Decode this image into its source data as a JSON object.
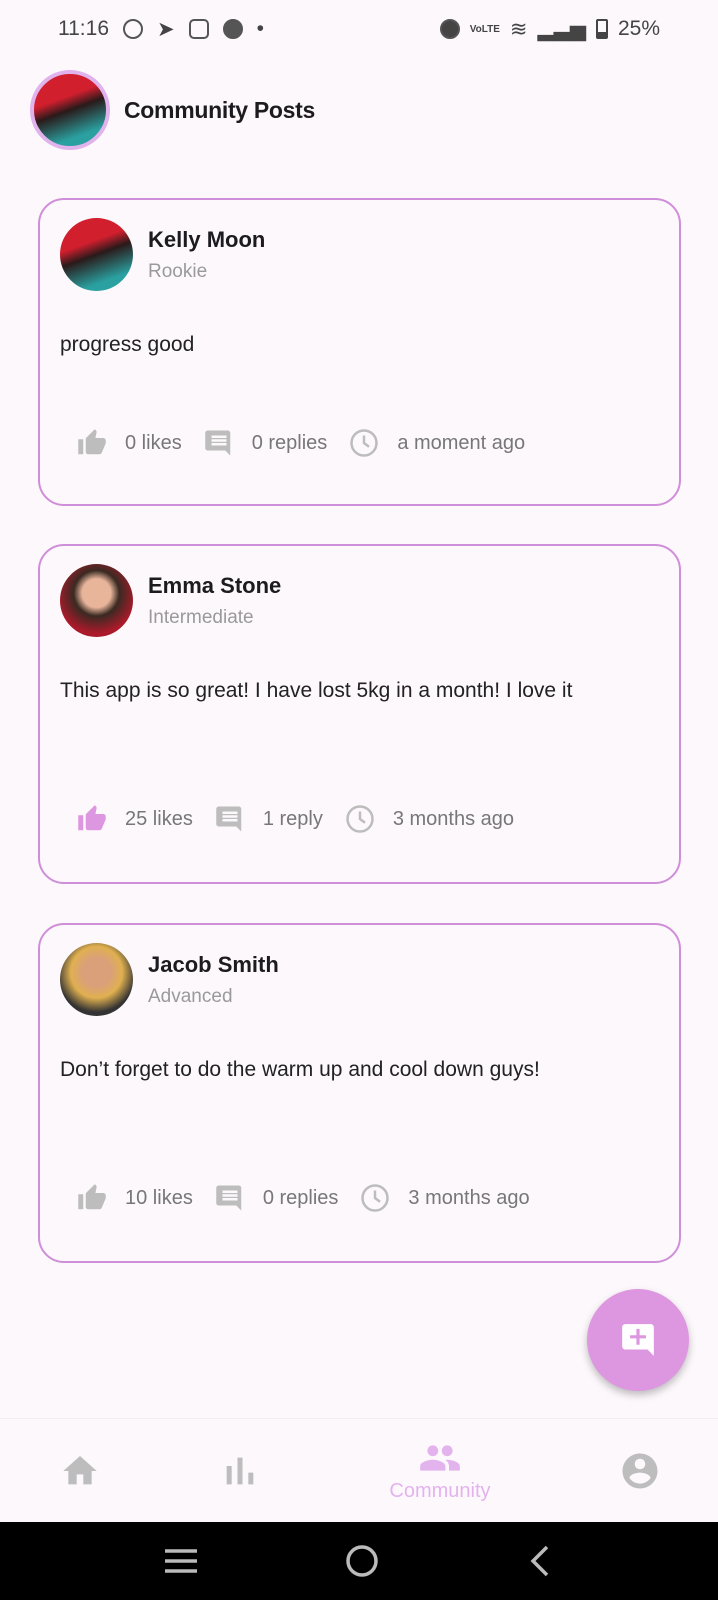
{
  "status_bar": {
    "time": "11:16",
    "battery": "25%",
    "icons": [
      "whatsapp-icon",
      "telegram-icon",
      "instagram-icon",
      "facebook-icon",
      "dot-icon",
      "dnd-icon",
      "volte-icon",
      "wifi-icon",
      "signal-icon",
      "battery-icon"
    ]
  },
  "header": {
    "title": "Community Posts"
  },
  "posts": [
    {
      "author": "Kelly Moon",
      "level": "Rookie",
      "text": "progress good",
      "likes": "0 likes",
      "replies": "0 replies",
      "time": "a moment ago",
      "liked": false
    },
    {
      "author": "Emma Stone",
      "level": "Intermediate",
      "text": "This app is so great! I have lost 5kg in a month! I love it",
      "likes": "25 likes",
      "replies": "1 reply",
      "time": "3 months ago",
      "liked": true
    },
    {
      "author": "Jacob Smith",
      "level": "Advanced",
      "text": "Don’t forget to do the warm up and cool down guys!",
      "likes": "10 likes",
      "replies": "0 replies",
      "time": "3 months ago",
      "liked": false
    }
  ],
  "nav": {
    "community_label": "Community"
  },
  "colors": {
    "accent": "#dd96e0",
    "border": "#cf8fd8",
    "icon_gray": "#bdbdbd"
  }
}
